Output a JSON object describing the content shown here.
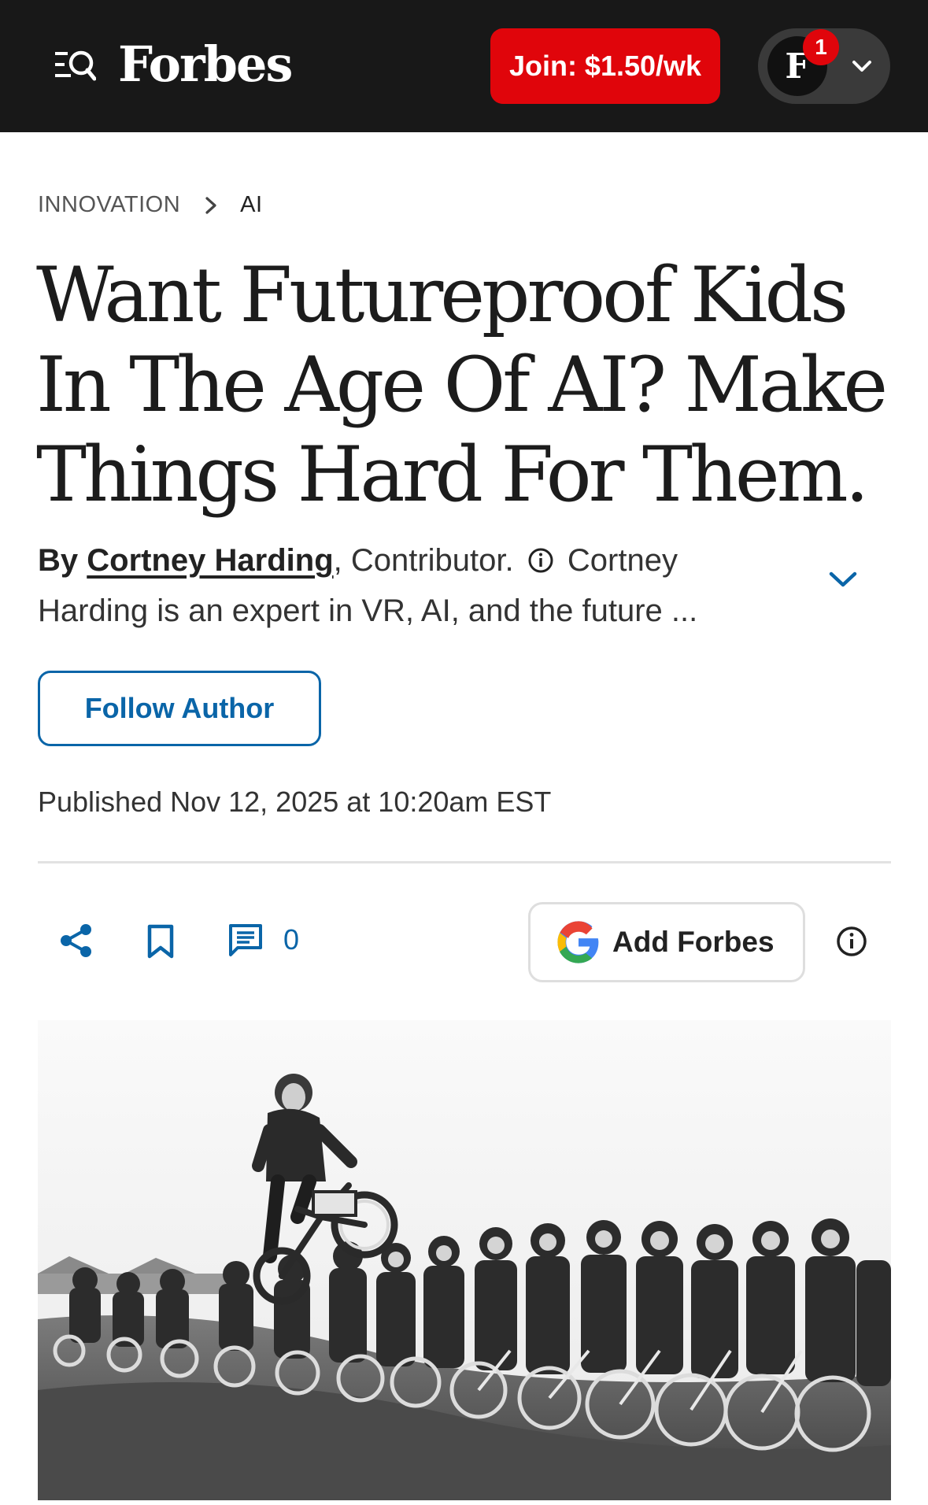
{
  "header": {
    "logo": "Forbes",
    "join_label": "Join: $1.50/wk",
    "account_initial": "F",
    "notification_count": "1"
  },
  "breadcrumb": {
    "section": "INNOVATION",
    "subsection": "AI"
  },
  "article": {
    "headline": "Want Futureproof Kids In The Age Of AI? Make Things Hard For Them.",
    "byline_prefix": "By",
    "author": "Cortney Harding",
    "role": ", Contributor.",
    "author_bio": "Cortney Harding is an expert in VR, AI, and the future ...",
    "follow_label": "Follow Author",
    "published": "Published Nov 12, 2025 at 10:20am EST"
  },
  "actions": {
    "comment_count": "0",
    "add_forbes_label": "Add Forbes"
  },
  "colors": {
    "brand_red": "#e0050b",
    "link_blue": "#0a65a8",
    "topbar": "#181818"
  },
  "icons": [
    "menu-search-icon",
    "chevron-down-icon",
    "breadcrumb-chevron-icon",
    "info-icon",
    "share-icon",
    "bookmark-icon",
    "comment-icon",
    "google-icon"
  ]
}
